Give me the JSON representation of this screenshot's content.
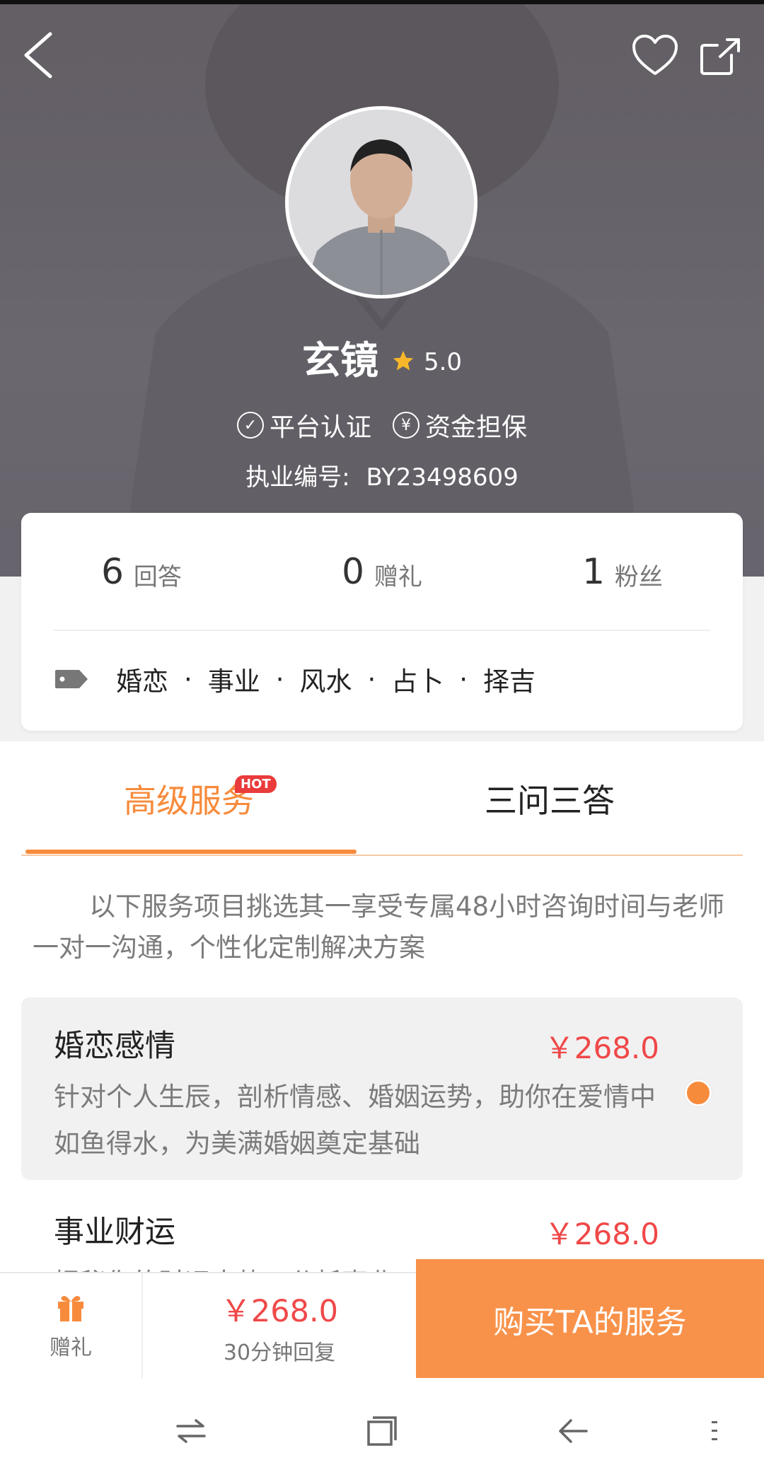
{
  "profile": {
    "name": "玄镜",
    "rating": "5.0",
    "badges": [
      {
        "icon": "check-circle-icon",
        "glyph": "✓",
        "label": "平台认证"
      },
      {
        "icon": "yen-circle-icon",
        "glyph": "¥",
        "label": "资金担保"
      }
    ],
    "license_label": "执业编号:",
    "license_number": "BY23498609"
  },
  "stats": [
    {
      "value": "6",
      "label": "回答"
    },
    {
      "value": "0",
      "label": "赠礼"
    },
    {
      "value": "1",
      "label": "粉丝"
    }
  ],
  "tags": [
    "婚恋",
    "事业",
    "风水",
    "占卜",
    "择吉"
  ],
  "tag_separator": "·",
  "tabs": {
    "active": "高级服务",
    "hot_badge": "HOT",
    "inactive": "三问三答"
  },
  "intro": "以下服务项目挑选其一享受专属48小时咨询时间与老师一对一沟通，个性化定制解决方案",
  "services": [
    {
      "title": "婚恋感情",
      "price": "￥268.0",
      "desc": "针对个人生辰，剖析情感、婚姻运势，助你在爱情中如鱼得水，为美满婚姻奠定基础",
      "selected": true
    },
    {
      "title": "事业财运",
      "price": "￥268.0",
      "desc": "揭秘你的财运大势，分析事业",
      "selected": false
    }
  ],
  "actionbar": {
    "gift_label": "赠礼",
    "price": "￥268.0",
    "reply_time": "30分钟回复",
    "buy_label": "购买TA的服务"
  },
  "colors": {
    "accent": "#f78b3c",
    "price": "#f04848",
    "buy_button": "#f8924a",
    "hot_badge": "#e93b3b"
  }
}
